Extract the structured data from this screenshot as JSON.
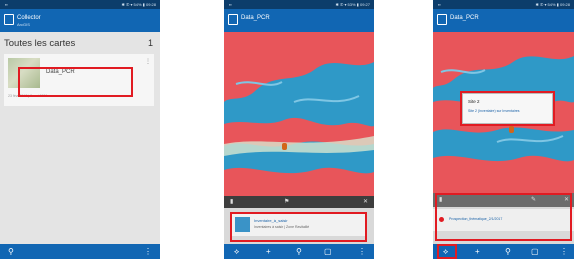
{
  "phone1": {
    "status_left": "▪▪",
    "status_right": "✱ ✆ ▾ 54% ▮ 09:28",
    "app_title": "Collector",
    "app_subtitle": "ArcGIS",
    "header": "Toutes les cartes",
    "count": "1",
    "card_title": "Data_PCR",
    "card_date": "23 févr.2017 | 3 mai 2021",
    "card_menu": "⋮",
    "bottom_search": "⚲",
    "bottom_menu": "⋮"
  },
  "phone2": {
    "status_left": "▪▪",
    "status_right": "✱ ✆ ▾ 53% ▮ 09:27",
    "app_title": "Data_PCR",
    "toolbar_close": "✕",
    "item_title": "Inventaire_à_saisir",
    "item_subtitle": "Inventaires à saisir | Zone Ravitaillé",
    "bottom_icons": [
      "⟡",
      "+",
      "⚲",
      "▢",
      "⋮"
    ]
  },
  "phone3": {
    "status_left": "▪▪",
    "status_right": "✱ ✆ ▾ 54% ▮ 09:28",
    "app_title": "Data_PCR",
    "popup_title": "Site 2",
    "popup_text": "Site 2 (Inventaire) sur Inventaires",
    "item_text": "Prospection_thématique_2/1/2017",
    "toolbar_close": "✕",
    "bottom_icons": [
      "⟡",
      "+",
      "⚲",
      "▢",
      "⋮"
    ]
  },
  "colors": {
    "appbar": "#1166b3",
    "water": "#2f99c7",
    "land": "#e8555a",
    "highlight": "#e11b22"
  }
}
